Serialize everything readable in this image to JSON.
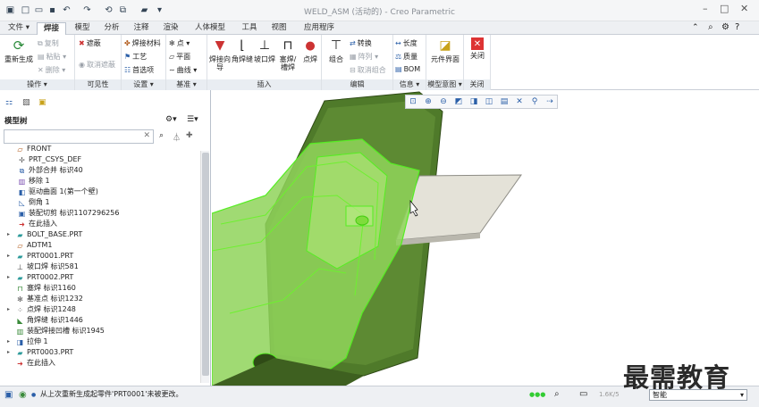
{
  "window": {
    "title": "WELD_ASM (活动的) - Creo Parametric"
  },
  "tabs": [
    "文件 ▾",
    "焊接",
    "模型",
    "分析",
    "注释",
    "渲染",
    "人体模型",
    "工具",
    "视图",
    "应用程序"
  ],
  "ribbon": {
    "groups": [
      "操作 ▾",
      "可见性",
      "设置 ▾",
      "基准 ▾",
      "插入",
      "编辑",
      "信息 ▾",
      "模型意图 ▾",
      "关闭"
    ],
    "ops": {
      "regen": "重新生成",
      "copy": "复制",
      "paste": "粘贴 ▾",
      "delete": "删除 ▾"
    },
    "vis": {
      "hide": "遮蔽",
      "unhide": "取消遮蔽"
    },
    "settings": {
      "material": "焊接材料",
      "process": "工艺",
      "params": "首选项"
    },
    "datum": {
      "point": "点 ▾",
      "plane": "平面",
      "curve": "曲线 ▾",
      "csys": "焊接"
    },
    "insert": [
      "焊接向导",
      "角焊缝",
      "坡口焊",
      "塞焊/槽焊",
      "点焊"
    ],
    "edit": {
      "combine": "组合",
      "convert": "转换",
      "pattern": "阵列 ▾",
      "ungroup": "取消组合"
    },
    "info": {
      "length": "长度",
      "mass": "质量",
      "bom": "BOM"
    },
    "intent": "元件界面",
    "close": "关闭"
  },
  "tree": {
    "header": "模型树",
    "rows": [
      "FRONT",
      "PRT_CSYS_DEF",
      "外部合并 标识40",
      "移除 1",
      "驱动曲面 1(第一个壁)",
      "倒角 1",
      "装配切剪 标识1107296256",
      "在此插入",
      "BOLT_BASE.PRT",
      "ADTM1",
      "PRT0001.PRT",
      "坡口焊 标识581",
      "PRT0002.PRT",
      "塞焊 标识1160",
      "基准点 标识1232",
      "点焊 标识1248",
      "角焊缝 标识1446",
      "装配焊接凹槽 标识1945",
      "拉伸 1",
      "PRT0003.PRT",
      "在此插入"
    ]
  },
  "status": {
    "message": "从上次重新生成起零件'PRT0001'未被更改。",
    "filter": "智能",
    "ratio": "1.6K/5"
  },
  "watermark": "最需教育"
}
